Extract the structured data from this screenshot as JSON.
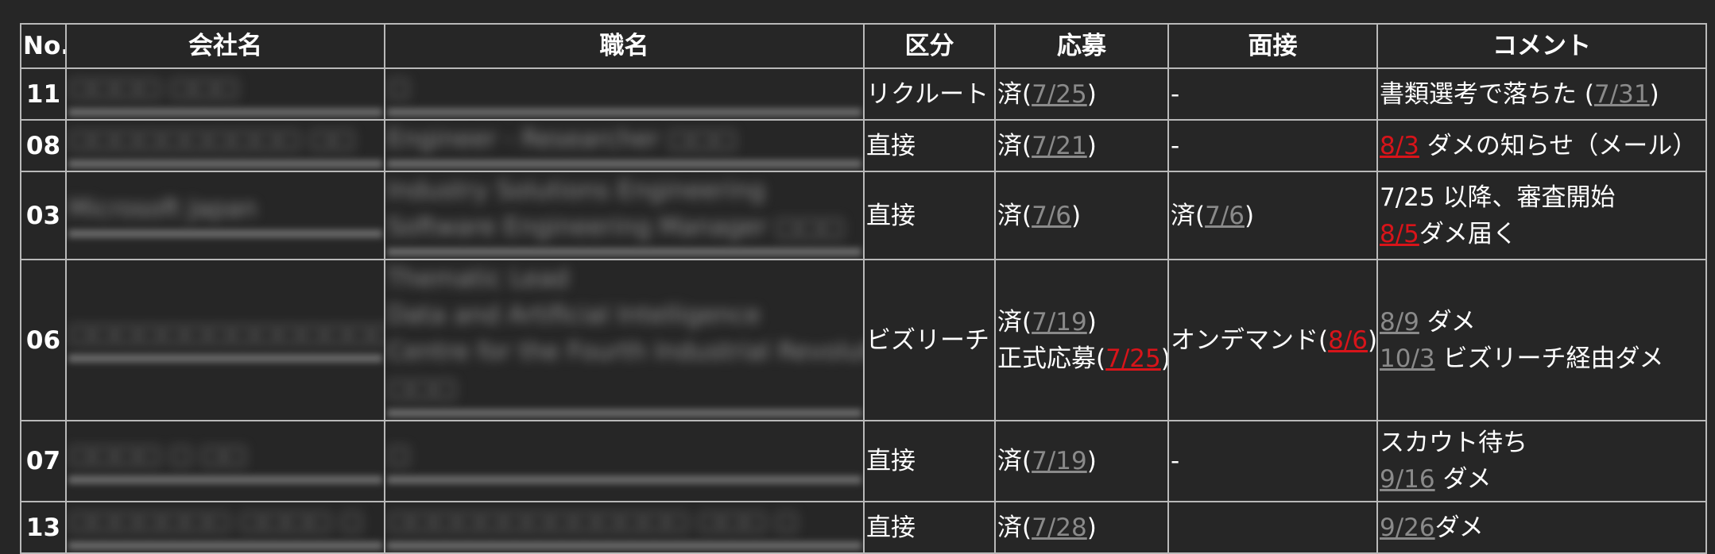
{
  "headers": {
    "no": "No.",
    "company": "会社名",
    "job": "職名",
    "category": "区分",
    "apply": "応募",
    "interview": "面接",
    "comment": "コメント"
  },
  "rows": [
    {
      "no": "11",
      "company_blur": "□□□□ □□□",
      "job_blur": [
        "□"
      ],
      "category": "リクルート",
      "apply": [
        {
          "pre": "済(",
          "date": "7/25",
          "date_color": "gray",
          "post": ")"
        }
      ],
      "interview": [
        {
          "pre": "-"
        }
      ],
      "comment": [
        {
          "pre": "書類選考で落ちた (",
          "date": "7/31",
          "date_color": "gray",
          "post": ")"
        }
      ]
    },
    {
      "no": "08",
      "company_blur": "□□□□□□□□□□ □□",
      "job_blur": [
        "Engineer - Researcher □□□"
      ],
      "category": "直接",
      "apply": [
        {
          "pre": "済(",
          "date": "7/21",
          "date_color": "gray",
          "post": ")"
        }
      ],
      "interview": [
        {
          "pre": "-"
        }
      ],
      "comment": [
        {
          "pre": "",
          "date": "8/3",
          "date_color": "red",
          "post": " ダメの知らせ（メール）"
        }
      ]
    },
    {
      "no": "03",
      "company_blur": "Microsoft Japan",
      "job_blur": [
        "Industry Solutions Engineering",
        "Software Engineering Manager □□□"
      ],
      "category": "直接",
      "apply": [
        {
          "pre": "済(",
          "date": "7/6",
          "date_color": "gray",
          "post": ")"
        }
      ],
      "interview": [
        {
          "pre": "済(",
          "date": "7/6",
          "date_color": "gray",
          "post": ")"
        }
      ],
      "comment": [
        {
          "pre": "7/25 以降、審査開始"
        },
        {
          "pre": "",
          "date": "8/5",
          "date_color": "red",
          "post": "ダメ届く"
        }
      ]
    },
    {
      "no": "06",
      "company_blur": "□□□□□□□□□□□□□□ □□□□□□",
      "job_blur": [
        "Thematic Lead",
        "Data and Artificial Intelligence",
        "Centre for the Fourth Industrial Revolution",
        "□□□"
      ],
      "category": "ビズリーチ",
      "apply": [
        {
          "pre": "済(",
          "date": "7/19",
          "date_color": "gray",
          "post": ")"
        },
        {
          "pre": "正式応募(",
          "date": "7/25",
          "date_color": "red",
          "post": ")"
        }
      ],
      "interview": [
        {
          "pre": "オンデマンド(",
          "date": "8/6",
          "date_color": "red",
          "post": ")"
        }
      ],
      "comment": [
        {
          "pre": "",
          "date": "8/9",
          "date_color": "gray",
          "post": " ダメ"
        },
        {
          "pre": "",
          "date": "10/3",
          "date_color": "gray",
          "post": " ビズリーチ経由ダメ"
        }
      ]
    },
    {
      "no": "07",
      "company_blur": "□□□□ □ □□",
      "job_blur": [
        "□"
      ],
      "category": "直接",
      "apply": [
        {
          "pre": "済(",
          "date": "7/19",
          "date_color": "gray",
          "post": ")"
        }
      ],
      "interview": [
        {
          "pre": "-"
        }
      ],
      "comment": [
        {
          "pre": "スカウト待ち"
        },
        {
          "pre": "",
          "date": "9/16",
          "date_color": "gray",
          "post": " ダメ"
        }
      ]
    },
    {
      "no": "13",
      "company_blur": "□□□□□□□ □□□□ □",
      "job_blur": [
        "□□□□□□□□□□□□□ □□□ □"
      ],
      "category": "直接",
      "apply": [
        {
          "pre": "済(",
          "date": "7/28",
          "date_color": "gray",
          "post": ")"
        }
      ],
      "interview": [],
      "comment": [
        {
          "pre": "",
          "date": "9/26",
          "date_color": "gray",
          "post": "ダメ"
        }
      ]
    }
  ],
  "colors": {
    "background": "#262626",
    "border": "#b9b9b9",
    "text": "#ffffff",
    "date_gray": "#8a8a8a",
    "date_red": "#d8141a"
  }
}
